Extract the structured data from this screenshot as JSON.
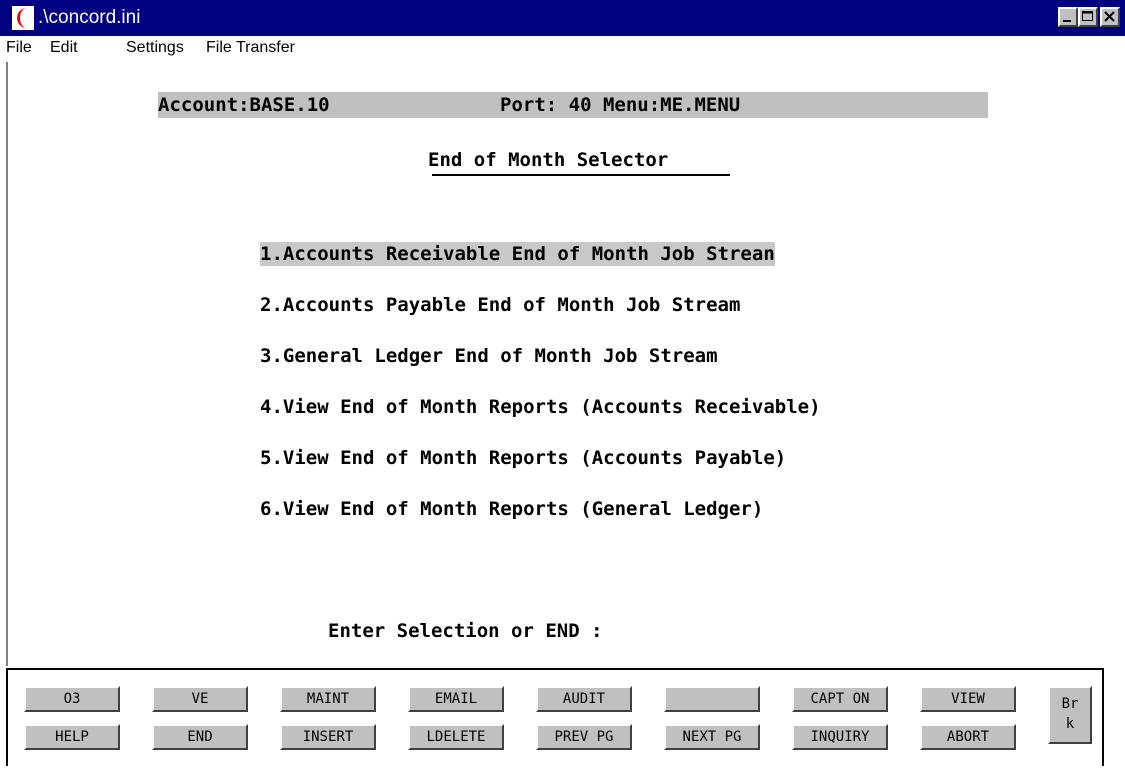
{
  "window": {
    "title": ".\\concord.ini",
    "icon": "concord-crescent-icon"
  },
  "menubar": {
    "items": [
      "File",
      "Edit",
      "Settings",
      "File Transfer"
    ]
  },
  "status": {
    "account": "Account:BASE.10",
    "port_menu": "Port: 40 Menu:ME.MENU"
  },
  "screen": {
    "heading": "End of Month Selector",
    "options": [
      "1.Accounts Receivable End of Month Job Strean",
      "2.Accounts Payable End of Month Job Stream",
      "3.General Ledger End of Month Job Stream",
      "4.View End of Month Reports (Accounts Receivable)",
      "5.View End of Month Reports (Accounts Payable)",
      "6.View End of Month Reports (General Ledger)"
    ],
    "prompt": "Enter Selection or END :"
  },
  "function_keys": {
    "row1": [
      "O3",
      "VE",
      "MAINT",
      "EMAIL",
      "AUDIT",
      "",
      "CAPT ON",
      "VIEW"
    ],
    "row2": [
      "HELP",
      "END",
      "INSERT",
      "LDELETE",
      "PREV PG",
      "NEXT PG",
      "INQUIRY",
      "ABORT"
    ],
    "brk_top": "Br",
    "brk_bottom": "k"
  },
  "colors": {
    "titlebar": "#000080",
    "button_face": "#c0c0c0",
    "highlight": "#c8c8c8"
  }
}
